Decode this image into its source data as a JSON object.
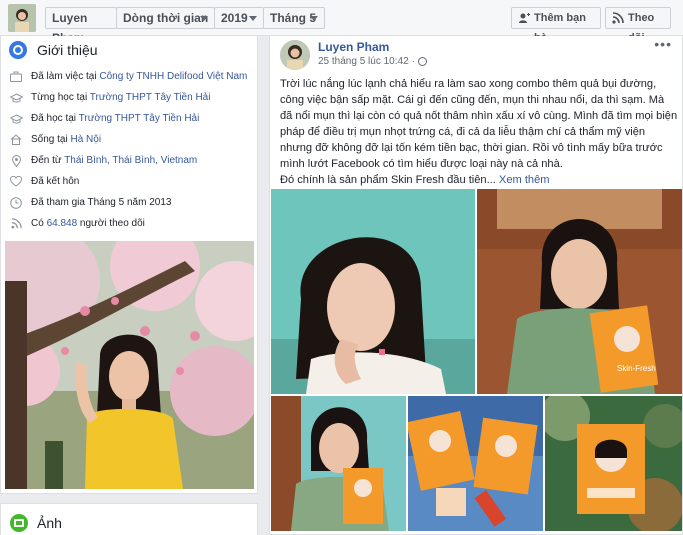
{
  "topbar": {
    "name_label": "Luyen Pham",
    "timeline_label": "Dòng thời gian",
    "year_label": "2019",
    "month_label": "Tháng 5",
    "add_friend_label": "Thêm bạn bè",
    "follow_label": "Theo dõi"
  },
  "intro": {
    "title": "Giới thiệu",
    "items": [
      {
        "icon": "briefcase-icon",
        "prefix": "Đã làm việc tại ",
        "link": "Công ty TNHH Delifood Việt Nam"
      },
      {
        "icon": "graduation-cap-icon",
        "prefix": "Từng học tại ",
        "link": "Trường THPT Tây Tiền Hải"
      },
      {
        "icon": "graduation-cap-icon",
        "prefix": "Đã học tại ",
        "link": "Trường THPT Tây Tiền Hải"
      },
      {
        "icon": "home-icon",
        "prefix": "Sống tại ",
        "link": "Hà Nội"
      },
      {
        "icon": "location-pin-icon",
        "prefix": "Đến từ ",
        "link": "Thái Bình, Thái Bình, Vietnam"
      },
      {
        "icon": "heart-icon",
        "prefix": "Đã kết hôn",
        "link": ""
      },
      {
        "icon": "clock-icon",
        "prefix": "Đã tham gia Tháng 5 năm 2013",
        "link": ""
      },
      {
        "icon": "rss-icon",
        "prefix": "Có ",
        "link": "64.848",
        "suffix": " người theo dõi"
      }
    ]
  },
  "photos": {
    "title": "Ảnh"
  },
  "post": {
    "author": "Luyen Pham",
    "time": "25 tháng 5 lúc 10:42",
    "dot": "·",
    "more_menu": "•••",
    "text": "Trời lúc nắng lúc lạnh chả hiểu ra làm sao xong combo thêm quả bụi đường, công việc bận sấp mặt. Cái gì đến cũng đến, mụn thi nhau nổi, da thì sạm. Mà đã nổi mụn thì lại còn có quả nốt thâm nhìn xấu xí vô cùng. Mình đã tìm mọi biện pháp để điều trị mụn nhọt trứng cá, đi cả da liễu thậm chí cả thẩm mỹ viện nhưng đỡ không đỡ lại tốn kém tiền bạc, thời gian. Rồi vô tình mấy bữa trước mình lướt Facebook có tìm hiểu được loại này nà cả nhà.",
    "text2": "Đó chính là sản phẩm Skin Fresh đầu tiên... ",
    "see_more": "Xem thêm",
    "product_label": "Skin-Fresh"
  },
  "colors": {
    "link": "#365899",
    "accent": "#3578e5",
    "box_orange": "#f39a2b"
  }
}
